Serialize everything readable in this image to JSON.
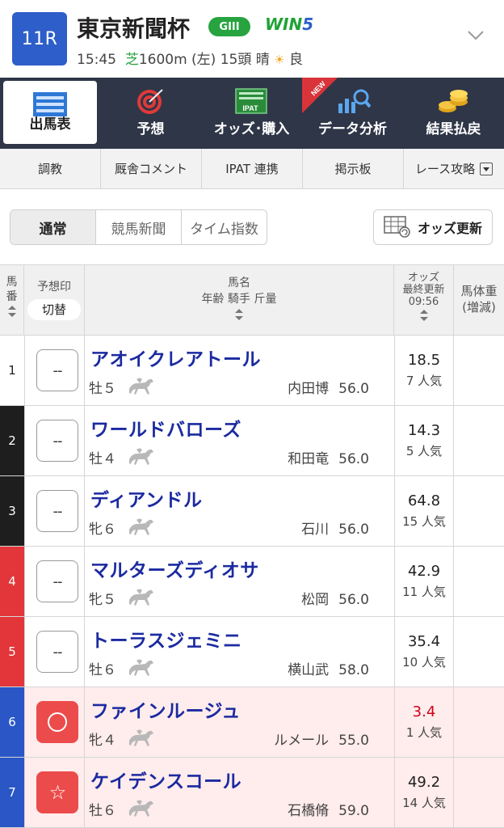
{
  "header": {
    "race_number": "11R",
    "title": "東京新聞杯",
    "grade": "GIII",
    "win5_prefix": "WIN",
    "win5_suffix": "5",
    "time": "15:45",
    "surface": "芝",
    "distance": "1600m (左) 15頭 晴",
    "condition": "良"
  },
  "main_nav": [
    {
      "label": "出馬表",
      "icon": "race-card-icon",
      "active": true
    },
    {
      "label": "予想",
      "icon": "target-icon"
    },
    {
      "label": "オッズ･購入",
      "icon": "ipat-icon"
    },
    {
      "label": "データ分析",
      "icon": "chart-search-icon",
      "badge": "NEW"
    },
    {
      "label": "結果払戻",
      "icon": "coins-icon"
    }
  ],
  "sub_nav": [
    "調教",
    "厩舎コメント",
    "IPAT 連携",
    "掲示板",
    "レース攻略"
  ],
  "view_tabs": [
    "通常",
    "競馬新聞",
    "タイム指数"
  ],
  "odds_update_label": "オッズ更新",
  "table_header": {
    "num_1": "馬",
    "num_2": "番",
    "mark": "予想印",
    "mark_toggle": "切替",
    "name": "馬名",
    "name_sub": "年齢 騎手 斤量",
    "odds_1": "オッズ",
    "odds_2": "最終更新",
    "odds_time": "09:56",
    "weight_1": "馬体重",
    "weight_2": "(増減)"
  },
  "horses": [
    {
      "num": "1",
      "name": "アオイクレアトール",
      "sexage": "牡５",
      "jockey": "内田博",
      "weight": "56.0",
      "odds": "18.5",
      "popularity": "7 人気",
      "mark": "--",
      "frame_color": "#ffffff",
      "num_color": "#222222"
    },
    {
      "num": "2",
      "name": "ワールドバローズ",
      "sexage": "牡４",
      "jockey": "和田竜",
      "weight": "56.0",
      "odds": "14.3",
      "popularity": "5 人気",
      "mark": "--",
      "frame_color": "#1e1e1e",
      "num_color": "#ffffff"
    },
    {
      "num": "3",
      "name": "ディアンドル",
      "sexage": "牝６",
      "jockey": "石川",
      "weight": "56.0",
      "odds": "64.8",
      "popularity": "15 人気",
      "mark": "--",
      "frame_color": "#1e1e1e",
      "num_color": "#ffffff"
    },
    {
      "num": "4",
      "name": "マルターズディオサ",
      "sexage": "牝５",
      "jockey": "松岡",
      "weight": "56.0",
      "odds": "42.9",
      "popularity": "11 人気",
      "mark": "--",
      "frame_color": "#e2363a",
      "num_color": "#ffffff"
    },
    {
      "num": "5",
      "name": "トーラスジェミニ",
      "sexage": "牡６",
      "jockey": "横山武",
      "weight": "58.0",
      "odds": "35.4",
      "popularity": "10 人気",
      "mark": "--",
      "frame_color": "#e2363a",
      "num_color": "#ffffff"
    },
    {
      "num": "6",
      "name": "ファインルージュ",
      "sexage": "牝４",
      "jockey": "ルメール",
      "weight": "55.0",
      "odds": "3.4",
      "popularity": "1 人気",
      "mark": "◯",
      "frame_color": "#2a56c6",
      "num_color": "#ffffff"
    },
    {
      "num": "7",
      "name": "ケイデンスコール",
      "sexage": "牡６",
      "jockey": "石橋脩",
      "weight": "59.0",
      "odds": "49.2",
      "popularity": "14 人気",
      "mark": "☆",
      "frame_color": "#2a56c6",
      "num_color": "#ffffff"
    }
  ],
  "colors": {
    "accent": "#2e5ec9",
    "nav_bg": "#2f3647",
    "grade_green": "#27a340",
    "name_blue": "#1b2aa0",
    "mark_red": "#ec4b4b",
    "highlight_row": "#ffecec",
    "low_odds": "#d0021b"
  }
}
